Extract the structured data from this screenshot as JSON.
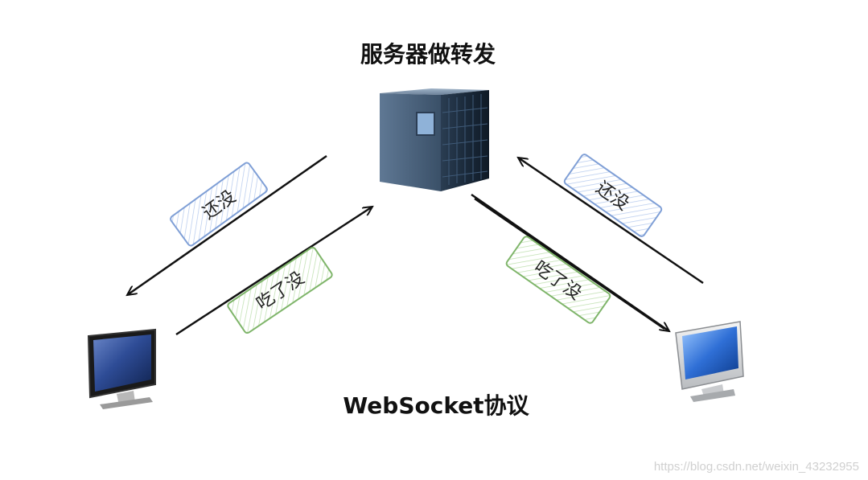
{
  "diagram": {
    "top_title": "服务器做转发",
    "bottom_title": "WebSocket协议",
    "watermark": "https://blog.csdn.net/weixin_43232955"
  },
  "nodes": {
    "server": {
      "icon": "server-rack-icon"
    },
    "left_client": {
      "icon": "monitor-icon"
    },
    "right_client": {
      "icon": "imac-monitor-icon"
    }
  },
  "edges": [
    {
      "from": "server",
      "to": "left_client",
      "label": "还没",
      "label_style": "blue"
    },
    {
      "from": "left_client",
      "to": "server",
      "label": "吃了没",
      "label_style": "green"
    },
    {
      "from": "server",
      "to": "right_client",
      "label": "吃了没",
      "label_style": "green"
    },
    {
      "from": "right_client",
      "to": "server",
      "label": "还没",
      "label_style": "blue"
    }
  ],
  "colors": {
    "blue_tag_stroke": "#7f9fd6",
    "blue_tag_hatch": "#b7cbee",
    "green_tag_stroke": "#7fb56a",
    "green_tag_hatch": "#bfe0b0",
    "arrow": "#111111",
    "screen_blue": "#2f6fd6"
  }
}
